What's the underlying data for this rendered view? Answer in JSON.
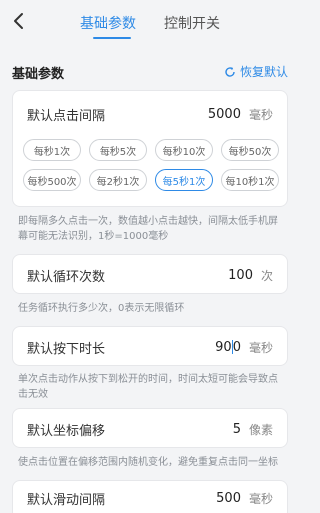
{
  "header": {
    "tabs": [
      {
        "label": "基础参数",
        "active": true
      },
      {
        "label": "控制开关",
        "active": false
      }
    ]
  },
  "section": {
    "title": "基础参数",
    "restore_label": "恢复默认"
  },
  "click_interval": {
    "label": "默认点击间隔",
    "value": "5000",
    "unit": "毫秒",
    "presets": [
      [
        "每秒1次",
        "每秒5次",
        "每秒10次",
        "每秒50次"
      ],
      [
        "每秒500次",
        "每2秒1次",
        "每5秒1次",
        "每10秒1次"
      ]
    ],
    "selected_preset": "每5秒1次",
    "hint": "即每隔多久点击一次，数值越小点击越快，间隔太低手机屏幕可能无法识别，1秒=1000毫秒"
  },
  "loop_count": {
    "label": "默认循环次数",
    "value": "100",
    "unit": "次",
    "hint": "任务循环执行多少次，0表示无限循环"
  },
  "press_duration": {
    "label": "默认按下时长",
    "value_before_caret": "90",
    "value_after_caret": "0",
    "unit": "毫秒",
    "hint": "单次点击动作从按下到松开的时间，时间太短可能会导致点击无效"
  },
  "coord_offset": {
    "label": "默认坐标偏移",
    "value": "5",
    "unit": "像素",
    "hint": "使点击位置在偏移范围内随机变化，避免重复点击同一坐标"
  },
  "swipe_interval": {
    "label": "默认滑动间隔",
    "value": "500",
    "unit": "毫秒"
  },
  "colors": {
    "accent": "#2e8ae6",
    "background": "#f3f4f6"
  }
}
